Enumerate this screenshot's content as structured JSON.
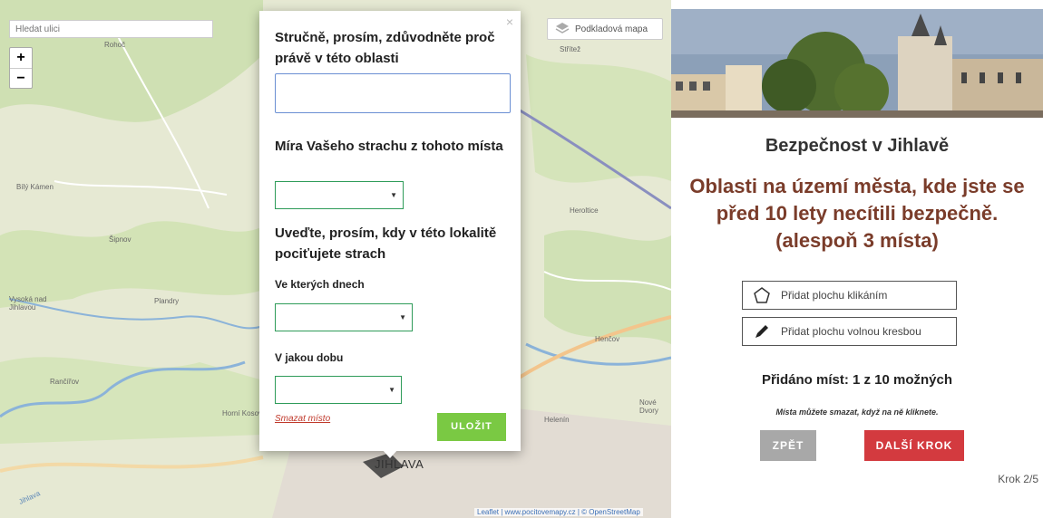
{
  "map": {
    "search_placeholder": "Hledat ulici",
    "zoom_in": "+",
    "zoom_out": "−",
    "layers_label": "Podkladová mapa",
    "city_label": "JIHLAVA",
    "attribution": "Leaflet | www.pocitovemapy.cz | © OpenStreetMap",
    "place_labels": [
      "Rohoč",
      "Bílý Kámen",
      "Šipnov",
      "Vysoká nad Jihlavou",
      "Plandry",
      "Rančířov",
      "Horní Kosov",
      "Heroltice",
      "Henčov",
      "Helenín",
      "Nové Dvory",
      "Střítež",
      "Jihlava"
    ]
  },
  "popup": {
    "close": "×",
    "question_reason": "Stručně, prosím, zdůvodněte proč právě v této oblasti",
    "reason_value": "",
    "question_fear": "Míra Vašeho strachu z tohoto místa",
    "question_when": "Uveďte, prosím, kdy v této lokalitě pociťujete strach",
    "days_label": "Ve kterých dnech",
    "time_label": "V jakou dobu",
    "delete_label": "Smazat místo",
    "save_label": "ULOŽIT"
  },
  "panel": {
    "title": "Bezpečnost v Jihlavě",
    "subtitle": "Oblasti na území města, kde jste se před 10 lety necítili bezpečně. (alespoň 3 místa)",
    "tool_click": "Přidat plochu klikáním",
    "tool_draw": "Přidat plochu volnou kresbou",
    "added_count": "Přidáno míst: 1 z 10 možných",
    "hint": "Místa můžete smazat, když na ně kliknete.",
    "back_label": "ZPĚT",
    "next_label": "DALŠÍ KROK",
    "step": "Krok 2/5"
  },
  "colors": {
    "accent_green": "#7ac943",
    "select_border": "#2e9b59",
    "next_red": "#d33a3f",
    "subtitle_brown": "#7a3c2a"
  }
}
